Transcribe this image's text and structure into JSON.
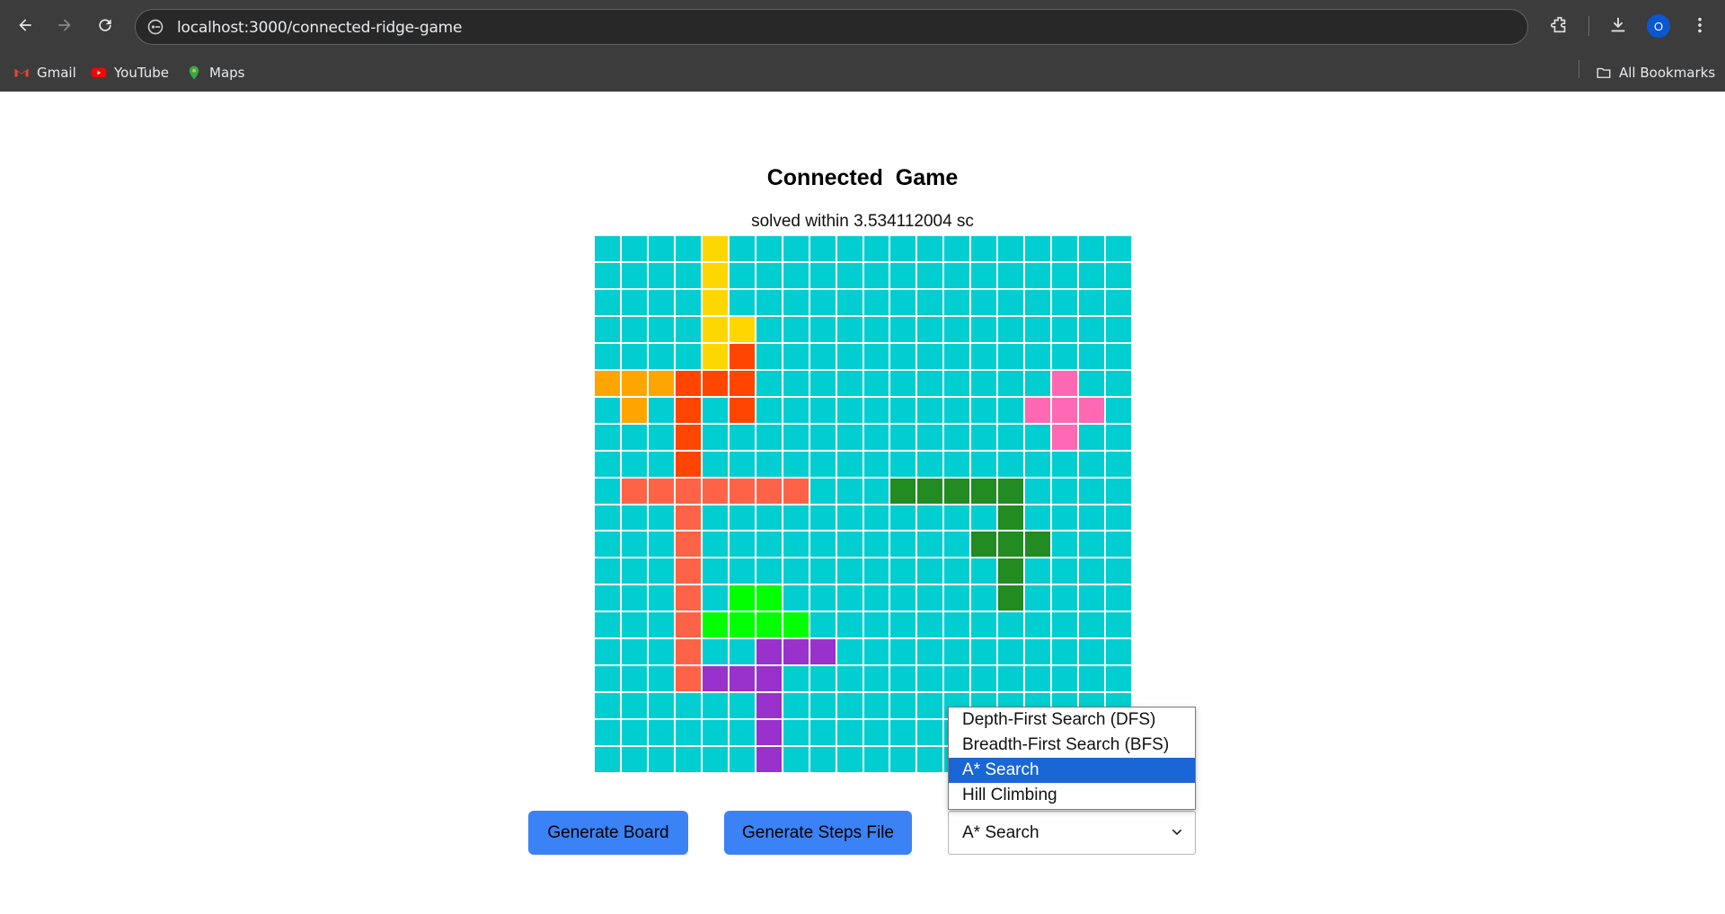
{
  "browser": {
    "url": "localhost:3000/connected-ridge-game",
    "profile_initial": "O",
    "bookmarks": [
      {
        "label": "Gmail",
        "icon": "gmail-icon"
      },
      {
        "label": "YouTube",
        "icon": "youtube-icon"
      },
      {
        "label": "Maps",
        "icon": "maps-icon"
      }
    ],
    "all_bookmarks_label": "All Bookmarks"
  },
  "page": {
    "title": "Connected  Game",
    "status": "solved within 3.534112004 sc"
  },
  "board": {
    "size": 20,
    "default_color": "#00ced1",
    "pieces": [
      {
        "color": "#ffd700",
        "cells": [
          [
            0,
            4
          ],
          [
            1,
            4
          ],
          [
            2,
            4
          ],
          [
            3,
            4
          ],
          [
            3,
            5
          ],
          [
            4,
            4
          ]
        ]
      },
      {
        "color": "#ffa500",
        "cells": [
          [
            5,
            0
          ],
          [
            5,
            1
          ],
          [
            5,
            2
          ],
          [
            6,
            1
          ]
        ]
      },
      {
        "color": "#ff4500",
        "cells": [
          [
            4,
            5
          ],
          [
            5,
            3
          ],
          [
            5,
            4
          ],
          [
            5,
            5
          ],
          [
            6,
            3
          ],
          [
            6,
            5
          ],
          [
            7,
            3
          ],
          [
            8,
            3
          ]
        ]
      },
      {
        "color": "#ff6347",
        "cells": [
          [
            9,
            1
          ],
          [
            9,
            2
          ],
          [
            9,
            3
          ],
          [
            9,
            4
          ],
          [
            9,
            5
          ],
          [
            9,
            6
          ],
          [
            9,
            7
          ],
          [
            10,
            3
          ],
          [
            11,
            3
          ],
          [
            12,
            3
          ],
          [
            13,
            3
          ],
          [
            14,
            3
          ],
          [
            15,
            3
          ],
          [
            16,
            3
          ]
        ]
      },
      {
        "color": "#ff69b4",
        "cells": [
          [
            5,
            17
          ],
          [
            6,
            16
          ],
          [
            6,
            17
          ],
          [
            6,
            18
          ],
          [
            7,
            17
          ]
        ]
      },
      {
        "color": "#228b22",
        "cells": [
          [
            9,
            11
          ],
          [
            9,
            12
          ],
          [
            9,
            13
          ],
          [
            9,
            14
          ],
          [
            9,
            15
          ],
          [
            10,
            15
          ],
          [
            11,
            14
          ],
          [
            11,
            15
          ],
          [
            11,
            16
          ],
          [
            12,
            15
          ],
          [
            13,
            15
          ]
        ]
      },
      {
        "color": "#00ff00",
        "cells": [
          [
            13,
            5
          ],
          [
            13,
            6
          ],
          [
            14,
            4
          ],
          [
            14,
            5
          ],
          [
            14,
            6
          ],
          [
            14,
            7
          ]
        ]
      },
      {
        "color": "#9932cc",
        "cells": [
          [
            15,
            6
          ],
          [
            15,
            7
          ],
          [
            15,
            8
          ],
          [
            16,
            4
          ],
          [
            16,
            5
          ],
          [
            16,
            6
          ],
          [
            17,
            6
          ],
          [
            18,
            6
          ],
          [
            19,
            6
          ]
        ]
      }
    ]
  },
  "controls": {
    "generate_board_label": "Generate Board",
    "generate_steps_label": "Generate Steps File",
    "algorithm_selected": "A* Search",
    "algorithm_options": [
      "Depth-First Search (DFS)",
      "Breadth-First Search (BFS)",
      "A* Search",
      "Hill Climbing"
    ],
    "highlighted_option_index": 2
  }
}
